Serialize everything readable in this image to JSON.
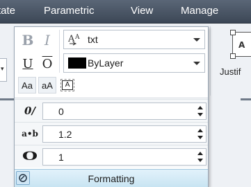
{
  "ribbon": {
    "tabs": [
      "tate",
      "Parametric",
      "View",
      "Manage"
    ]
  },
  "formatting_panel": {
    "title": "Formatting",
    "bold_label": "B",
    "italic_label": "I",
    "underline_label": "U",
    "overline_label": "O",
    "lowercase_label": "Aa",
    "uppercase_label": "aA",
    "background_mask_label": "A",
    "font": {
      "value": "txt",
      "icon": "font-icon"
    },
    "color": {
      "value": "ByLayer",
      "swatch": "#000000"
    },
    "oblique": {
      "icon_label": "0/",
      "value": "0"
    },
    "tracking": {
      "icon_label": "a•b",
      "value": "1.2"
    },
    "width_factor": {
      "icon_label": "O",
      "value": "1"
    }
  },
  "background": {
    "justify_label": "Justif",
    "justify_icon_letter": "A",
    "dropdown_stub_arrow": "▾"
  },
  "colors": {
    "panel_title_bg": "#c8e4f2",
    "tab_bar_bg": "#4a5565"
  }
}
